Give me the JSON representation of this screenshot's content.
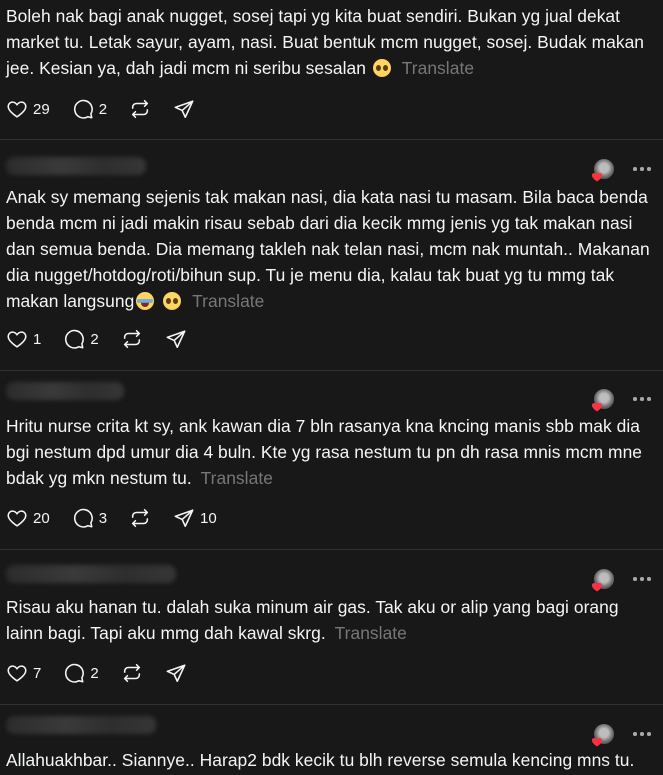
{
  "posts": [
    {
      "text": "Boleh nak bagi anak nugget, sosej tapi yg kita buat sendiri. Bukan yg jual dekat market tu. Letak sayur, ayam, nasi. Buat bentuk mcm nugget, sosej. Budak makan jee. Kesian ya, dah jadi mcm ni seribu sesalan",
      "emojis": [
        "pleading-face"
      ],
      "translate": "Translate",
      "likes": "29",
      "replies": "2",
      "reposts": "",
      "shares": ""
    },
    {
      "text": "Anak sy memang sejenis tak makan nasi, dia kata nasi tu masam. Bila baca benda benda mcm ni jadi makin risau sebab dari dia kecik mmg jenis yg tak makan nasi dan semua benda. Dia memang takleh nak telan nasi, mcm nak muntah.. Makanan dia nugget/hotdog/roti/bihun sup. Tu je menu dia, kalau tak buat yg tu mmg tak makan langsung",
      "emojis": [
        "crying-face",
        "pleading-face"
      ],
      "translate": "Translate",
      "likes": "1",
      "replies": "2",
      "reposts": "",
      "shares": ""
    },
    {
      "text": "Hritu nurse crita kt sy, ank kawan dia 7 bln rasanya kna kncing manis sbb mak dia bgi nestum dpd umur dia 4 buln. Kte yg rasa nestum tu pn dh rasa mnis mcm mne bdak yg mkn nestum tu.",
      "emojis": [],
      "translate": "Translate",
      "likes": "20",
      "replies": "3",
      "reposts": "",
      "shares": "10"
    },
    {
      "text": "Risau aku hanan tu. dalah suka minum air gas. Tak aku or alip yang bagi orang lainn bagi. Tapi aku mmg dah kawal skrg.",
      "emojis": [],
      "translate": "Translate",
      "likes": "7",
      "replies": "2",
      "reposts": "",
      "shares": ""
    },
    {
      "text": "Allahuakhbar.. Siannye.. Harap2 bdk kecik tu blh reverse semula kencing mns tu.",
      "emojis": [],
      "translate": "",
      "likes": "",
      "replies": "",
      "reposts": "",
      "shares": ""
    }
  ],
  "icons": {
    "like": "heart-outline-icon",
    "reply": "speech-bubble-icon",
    "repost": "repost-arrows-icon",
    "share": "paper-plane-icon",
    "more": "more-dots-icon",
    "liked_by_author": "red-heart-icon"
  },
  "colors": {
    "background": "#181818",
    "text": "#f3f5f7",
    "muted": "#777777",
    "separator": "#323232",
    "heart": "#ff3040"
  }
}
